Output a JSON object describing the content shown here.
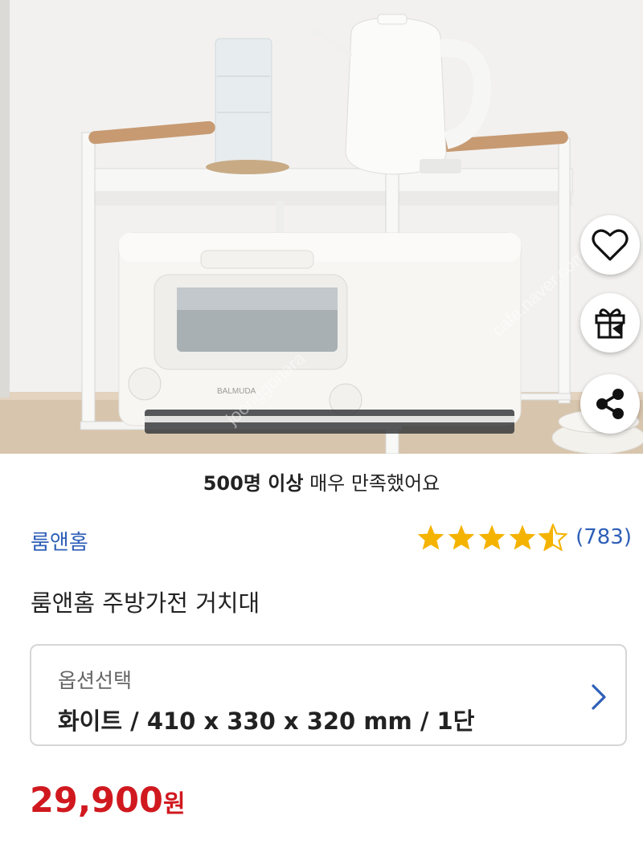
{
  "hero": {
    "watermark_1": "cafe.naver.com",
    "watermark_2": "joonggonara",
    "toaster_brand": "BALMUDA",
    "actions": {
      "like_icon": "heart-icon",
      "gift_icon": "gift-icon",
      "share_icon": "share-icon"
    }
  },
  "satisfaction": {
    "highlight": "500명 이상",
    "rest": " 매우 만족했어요"
  },
  "product": {
    "brand": "룸앤홈",
    "rating_value": 4.5,
    "review_count": "(783)",
    "title": "룸앤홈 주방가전 거치대"
  },
  "option": {
    "label": "옵션선택",
    "selected": "화이트 / 410 x 330 x 320 mm / 1단"
  },
  "price": {
    "amount": "29,900",
    "currency": "원"
  },
  "colors": {
    "accent_blue": "#2f5fb8",
    "price_red": "#d0191f",
    "star_gold": "#f5b301"
  }
}
